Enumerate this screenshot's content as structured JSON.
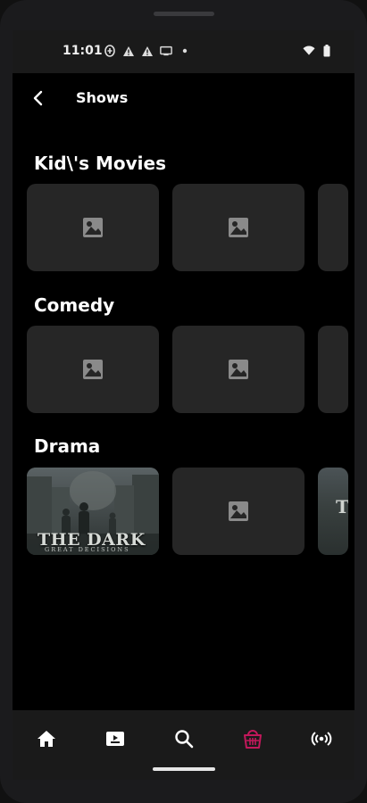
{
  "status_bar": {
    "time": "11:01",
    "icons": [
      "data-saver-icon",
      "warning-icon",
      "warning-icon",
      "cast-icon",
      "dot-icon"
    ],
    "right_icons": [
      "wifi-icon",
      "battery-icon"
    ]
  },
  "header": {
    "title": "Shows",
    "back_icon": "back-arrow-icon"
  },
  "sections": [
    {
      "title": "Kid\\'s Movies",
      "cards": [
        "placeholder",
        "placeholder",
        "placeholder"
      ]
    },
    {
      "title": "Comedy",
      "cards": [
        "placeholder",
        "placeholder",
        "placeholder"
      ]
    },
    {
      "title": "Drama",
      "cards": [
        "poster",
        "placeholder",
        "poster"
      ]
    }
  ],
  "poster": {
    "title": "THE DARK",
    "subtitle": "GREAT DECISIONS",
    "peek_letter": "T"
  },
  "bottom_nav": {
    "items": [
      "home-icon",
      "video-icon",
      "search-icon",
      "basket-icon",
      "broadcast-icon"
    ],
    "active_index": 3,
    "active_color": "#c2185b",
    "inactive_color": "#ffffff"
  }
}
